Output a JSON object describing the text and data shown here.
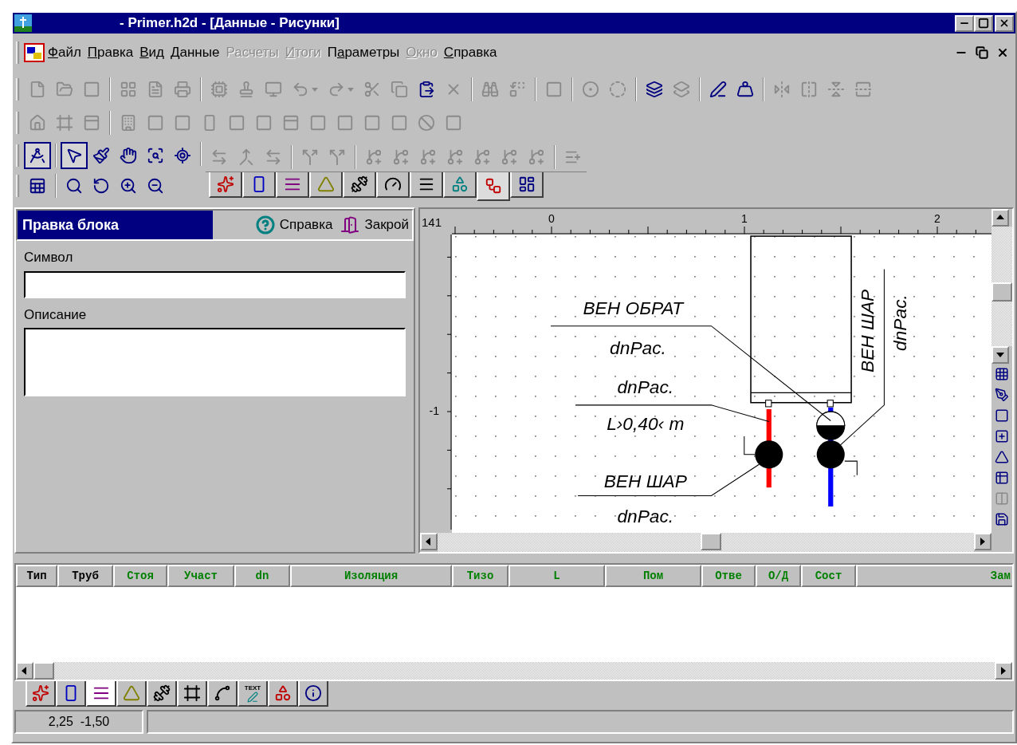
{
  "window": {
    "title": "- Primer.h2d - [Данные - Рисунки]"
  },
  "menu": [
    {
      "key": "Ф",
      "post": "айл",
      "disabled": false
    },
    {
      "key": "П",
      "post": "равка",
      "disabled": false
    },
    {
      "key": "В",
      "post": "ид",
      "disabled": false
    },
    {
      "key": "Д",
      "post": "анные",
      "disabled": false
    },
    {
      "pre": "Расчеты",
      "disabled": true
    },
    {
      "key": "И",
      "post": "тоги",
      "disabled": true
    },
    {
      "pre": "П",
      "key": "а",
      "post": "раметры",
      "disabled": false
    },
    {
      "key": "О",
      "post": "кно",
      "disabled": true
    },
    {
      "key": "С",
      "post": "правка",
      "disabled": false
    }
  ],
  "standard_toolbar": [
    [
      {
        "disabled": true
      },
      {
        "disabled": true
      },
      {
        "disabled": true
      }
    ],
    [
      {
        "disabled": true
      },
      {
        "disabled": true
      },
      {
        "disabled": true
      }
    ],
    [
      {
        "disabled": true
      },
      {
        "disabled": true
      },
      {
        "disabled": true
      },
      {
        "disabled": true,
        "dropdown": true
      },
      {
        "disabled": true,
        "dropdown": true
      },
      {
        "disabled": true
      },
      {
        "disabled": true
      },
      {
        "disabled": false
      },
      {
        "disabled": true
      }
    ],
    [
      {
        "disabled": true
      },
      {
        "disabled": true
      }
    ],
    [
      {
        "disabled": true
      }
    ],
    [
      {
        "disabled": true
      },
      {
        "disabled": true
      }
    ],
    [
      {
        "disabled": false
      },
      {
        "disabled": true
      }
    ],
    [
      {
        "disabled": false
      },
      {
        "disabled": false
      }
    ],
    [
      {
        "disabled": true
      },
      {
        "disabled": true
      },
      {
        "disabled": true
      },
      {
        "disabled": true
      }
    ]
  ],
  "building_toolbar": [
    [
      {
        "disabled": true
      },
      {
        "disabled": true
      },
      {
        "disabled": true
      }
    ],
    [
      {
        "disabled": true
      },
      {
        "disabled": true
      },
      {
        "disabled": true
      },
      {
        "disabled": true
      },
      {
        "disabled": true
      },
      {
        "disabled": true
      },
      {
        "disabled": true
      },
      {
        "disabled": true
      },
      {
        "disabled": true
      },
      {
        "disabled": true
      },
      {
        "disabled": true
      },
      {
        "disabled": true
      },
      {
        "disabled": true
      }
    ]
  ],
  "draw_tools": [
    [
      [
        {
          "selected": true,
          "disabled": false
        }
      ],
      [
        {
          "selected": true,
          "disabled": false
        },
        {
          "selected": false,
          "disabled": false
        },
        {
          "selected": false,
          "disabled": false
        },
        {
          "selected": false,
          "disabled": false
        },
        {
          "selected": false,
          "disabled": false
        }
      ]
    ],
    [
      [
        {
          "selected": false,
          "disabled": false
        }
      ],
      [
        {
          "selected": false,
          "disabled": false
        },
        {
          "selected": false,
          "disabled": false
        },
        {
          "selected": false,
          "disabled": false
        },
        {
          "selected": false,
          "disabled": false
        }
      ]
    ]
  ],
  "structure_tools": [
    [
      {
        "disabled": true
      },
      {
        "disabled": true
      },
      {
        "disabled": true
      }
    ],
    [
      {
        "disabled": true
      },
      {
        "disabled": true
      }
    ],
    [
      {
        "disabled": true
      },
      {
        "disabled": true
      },
      {
        "disabled": true
      },
      {
        "disabled": true
      },
      {
        "disabled": true
      },
      {
        "disabled": true
      },
      {
        "disabled": true
      }
    ],
    [
      {
        "disabled": true
      }
    ]
  ],
  "element_tabs": [
    {
      "selected": false
    },
    {
      "selected": false
    },
    {
      "selected": false
    },
    {
      "selected": false
    },
    {
      "selected": false
    },
    {
      "selected": false
    },
    {
      "selected": false
    },
    {
      "selected": false
    },
    {
      "selected": true
    },
    {
      "selected": false
    }
  ],
  "block_panel": {
    "title": "Правка блока",
    "help_button": "Справка",
    "close_button": "Закрой",
    "symbol_label": "Символ",
    "description_label": "Описание"
  },
  "canvas": {
    "corner": "141",
    "x_ruler": [
      "0",
      "1",
      "2"
    ],
    "y_ruler": [
      "-1"
    ],
    "labels": [
      {
        "text": "ВЕН ОБРАТ"
      },
      {
        "text": "dnPac."
      },
      {
        "text": "dnPac."
      },
      {
        "text": "L›0,40‹ m"
      },
      {
        "text": "ВЕН ШАР"
      },
      {
        "text": "dnPac."
      },
      {
        "text": "ВЕН ШАР"
      },
      {
        "text": "dnPac."
      }
    ],
    "tools": [
      {
        "disabled": false
      },
      {
        "disabled": false
      },
      {
        "disabled": false
      },
      {
        "disabled": false
      },
      {
        "disabled": false
      },
      {
        "disabled": false
      },
      {
        "disabled": true
      },
      {
        "disabled": false
      }
    ]
  },
  "table": {
    "columns": [
      {
        "label": "Тип",
        "color": "#000000"
      },
      {
        "label": "Труб",
        "color": "#000000"
      },
      {
        "label": "Стоя",
        "color": "#008000"
      },
      {
        "label": "Участ",
        "color": "#008000"
      },
      {
        "label": "dn",
        "color": "#008000"
      },
      {
        "label": "Изоляция",
        "color": "#008000"
      },
      {
        "label": "Тизо",
        "color": "#008000"
      },
      {
        "label": "L",
        "color": "#008000"
      },
      {
        "label": "Пом",
        "color": "#008000"
      },
      {
        "label": "Отве",
        "color": "#008000"
      },
      {
        "label": "О/Д",
        "color": "#008000"
      },
      {
        "label": "Сост",
        "color": "#008000"
      },
      {
        "label": "Зам",
        "color": "#008000"
      }
    ]
  },
  "bottom_tabs": [
    {
      "selected": false
    },
    {
      "selected": false
    },
    {
      "selected": true
    },
    {
      "selected": false
    },
    {
      "selected": false
    },
    {
      "selected": false
    },
    {
      "selected": false
    },
    {
      "selected": false,
      "label": "TEXT"
    },
    {
      "selected": false
    },
    {
      "selected": false
    }
  ],
  "status_bar": {
    "coordinates": "2,25  -1,50"
  }
}
